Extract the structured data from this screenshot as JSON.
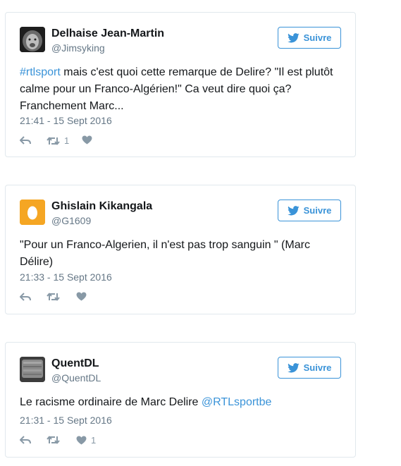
{
  "follow_label": "Suivre",
  "colors": {
    "link": "#3a93d8",
    "border": "#e1e8ed",
    "muted": "#657786",
    "icon": "#8899a6"
  },
  "tweets": [
    {
      "name": "Delhaise Jean-Martin",
      "handle": "@Jimsyking",
      "avatar": "lion-photo",
      "hashtag": "#rtlsport",
      "text": " mais c'est quoi cette remarque de Delire? \"Il est plutôt calme pour un Franco-Algérien!\" Ca veut dire quoi ça? Franchement Marc...",
      "mention": "",
      "time": "21:41 - 15 Sept 2016",
      "retweets": "1",
      "likes": ""
    },
    {
      "name": "Ghislain Kikangala",
      "handle": "@G1609",
      "avatar": "egg-default",
      "hashtag": "",
      "text": "\"Pour un Franco-Algerien, il n'est pas trop sanguin \" (Marc Délire)",
      "mention": "",
      "time": "21:33 - 15 Sept 2016",
      "retweets": "",
      "likes": ""
    },
    {
      "name": "QuentDL",
      "handle": "@QuentDL",
      "avatar": "tv-static",
      "hashtag": "",
      "text": "Le racisme ordinaire de Marc Delire ",
      "mention": "@RTLsportbe",
      "time": "21:31 - 15 Sept 2016",
      "retweets": "",
      "likes": "1"
    }
  ]
}
